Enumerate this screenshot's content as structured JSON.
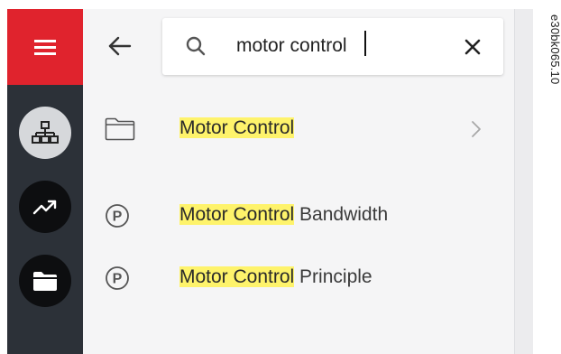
{
  "sidebar": {
    "menu_icon": "hamburger-icon",
    "items": [
      {
        "icon": "hierarchy-icon",
        "active": true
      },
      {
        "icon": "trend-chart-icon",
        "active": false
      },
      {
        "icon": "folder-icon",
        "active": false
      }
    ]
  },
  "search": {
    "back_icon": "back-arrow-icon",
    "search_icon": "search-icon",
    "value": "motor control",
    "clear_icon": "close-icon"
  },
  "results": [
    {
      "type": "folder",
      "icon": "folder-outline-icon",
      "highlight": "Motor Control",
      "rest": "",
      "has_chevron": true
    },
    {
      "type": "parameter",
      "icon": "parameter-p-icon",
      "highlight": "Motor Control",
      "rest": " Bandwidth",
      "has_chevron": false
    },
    {
      "type": "parameter",
      "icon": "parameter-p-icon",
      "highlight": "Motor Control",
      "rest": " Principle",
      "has_chevron": false
    }
  ],
  "figure_code": "e30bk065.10",
  "colors": {
    "accent_red": "#e0232d",
    "rail": "#2c3138",
    "highlight": "#fef36b",
    "panel": "#f5f5f6"
  }
}
